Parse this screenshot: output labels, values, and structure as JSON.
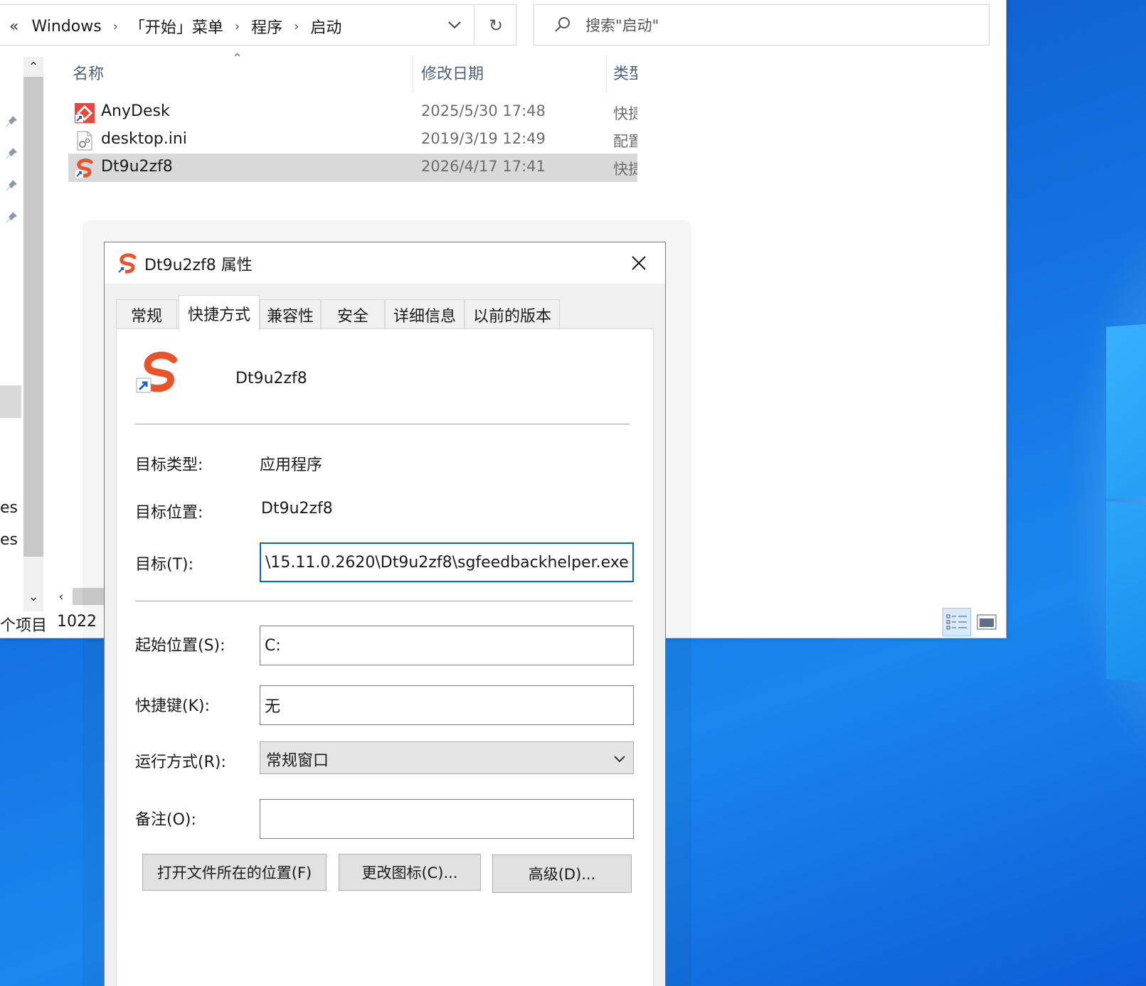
{
  "explorer": {
    "breadcrumb": {
      "back_glyph": "«",
      "items": [
        "Windows",
        "「开始」菜单",
        "程序",
        "启动"
      ]
    },
    "search": {
      "placeholder": "搜索\"启动\""
    },
    "columns": {
      "name": "名称",
      "modified": "修改日期",
      "type": "类型"
    },
    "files": [
      {
        "name": "AnyDesk",
        "modified": "2025/5/30 17:48",
        "type": "快捷方式",
        "icon": "anydesk-shortcut-icon"
      },
      {
        "name": "desktop.ini",
        "modified": "2019/3/19 12:49",
        "type": "配置设置",
        "icon": "settings-file-icon"
      },
      {
        "name": "Dt9u2zf8",
        "modified": "2026/4/17 17:41",
        "type": "快捷方式",
        "icon": "sogou-shortcut-icon"
      }
    ],
    "selected_file": "Dt9u2zf8",
    "nav_partial_labels": [
      "es",
      "es"
    ],
    "status": {
      "item_count": "个项目",
      "selected": "1022"
    }
  },
  "dialog": {
    "title": "Dt9u2zf8 属性",
    "tabs": [
      "常规",
      "快捷方式",
      "兼容性",
      "安全",
      "详细信息",
      "以前的版本"
    ],
    "active_tab": "快捷方式",
    "shortcut_name": "Dt9u2zf8",
    "target_type_label": "目标类型:",
    "target_type_value": "应用程序",
    "target_location_label": "目标位置:",
    "target_location_value": "Dt9u2zf8",
    "target_label": "目标(T):",
    "target_value": "\\15.11.0.2620\\Dt9u2zf8\\sgfeedbackhelper.exe\"",
    "start_in_label": "起始位置(S):",
    "start_in_value": "C:",
    "hotkey_label": "快捷键(K):",
    "hotkey_value": "无",
    "run_label": "运行方式(R):",
    "run_value": "常规窗口",
    "comment_label": "备注(O):",
    "comment_value": "",
    "buttons": {
      "open_location": "打开文件所在的位置(F)",
      "change_icon": "更改图标(C)...",
      "advanced": "高级(D)..."
    }
  },
  "colors": {
    "accent": "#0a64c8",
    "desktop": "#1472e0",
    "selection": "#d9d9d9",
    "sogou_orange": "#e8532a"
  }
}
